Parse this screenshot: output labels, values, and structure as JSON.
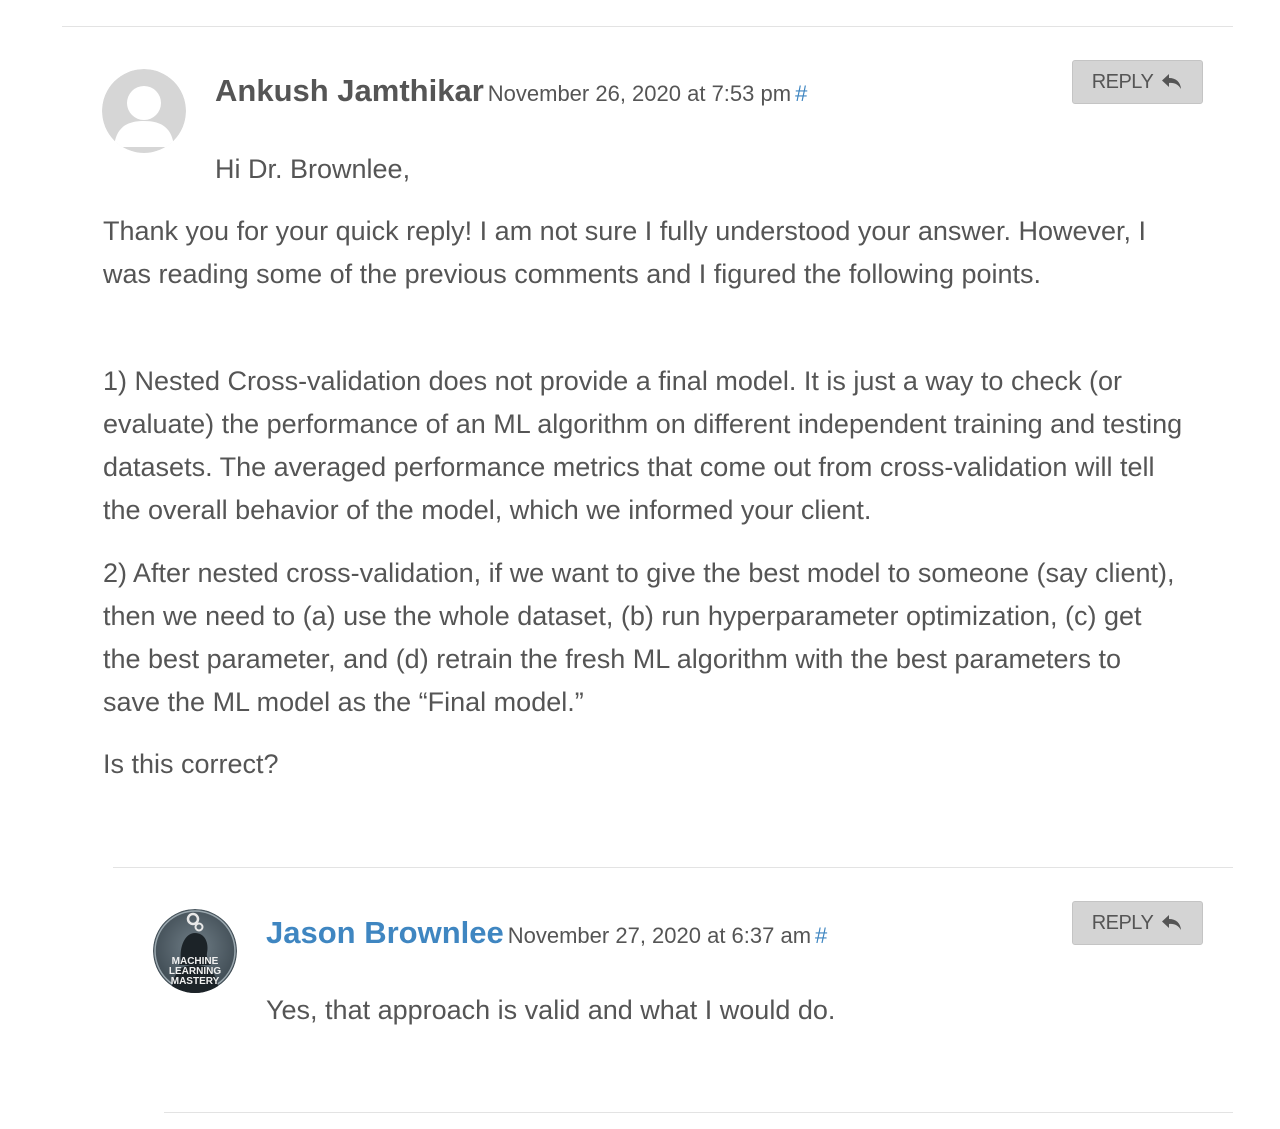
{
  "comment1": {
    "author": "Ankush Jamthikar",
    "date": "November 26, 2020 at 7:53 pm",
    "permalink": "#",
    "reply_label": "REPLY",
    "avatar": "default-user-avatar",
    "greeting": "Hi Dr. Brownlee,",
    "paragraphs": [
      "Thank you for your quick reply! I am not sure I fully understood your answer. However, I was reading some of the previous comments and I figured the following points.",
      "1) Nested Cross-validation does not provide a final model. It is just a way to check (or evaluate) the performance of an ML algorithm on different independent training and testing datasets. The averaged performance metrics that come out from cross-validation will tell the overall behavior of the model, which we informed your client.",
      "2) After nested cross-validation, if we want to give the best model to someone (say client), then we need to (a) use the whole dataset, (b) run hyperparameter optimization, (c) get the best parameter, and (d) retrain the fresh ML algorithm with the best parameters to save the ML model as the “Final model.”",
      "Is this correct?"
    ]
  },
  "comment2": {
    "author": "Jason Brownlee",
    "date": "November 27, 2020 at 6:37 am",
    "permalink": "#",
    "reply_label": "REPLY",
    "avatar": "machine-learning-mastery-logo",
    "avatar_text": [
      "MACHINE",
      "LEARNING",
      "MASTERY"
    ],
    "body": "Yes, that approach is valid and what I would do."
  },
  "colors": {
    "text": "#555555",
    "link": "#3f86c1",
    "button_bg": "#d4d4d4",
    "divider": "#e3e3e3"
  }
}
